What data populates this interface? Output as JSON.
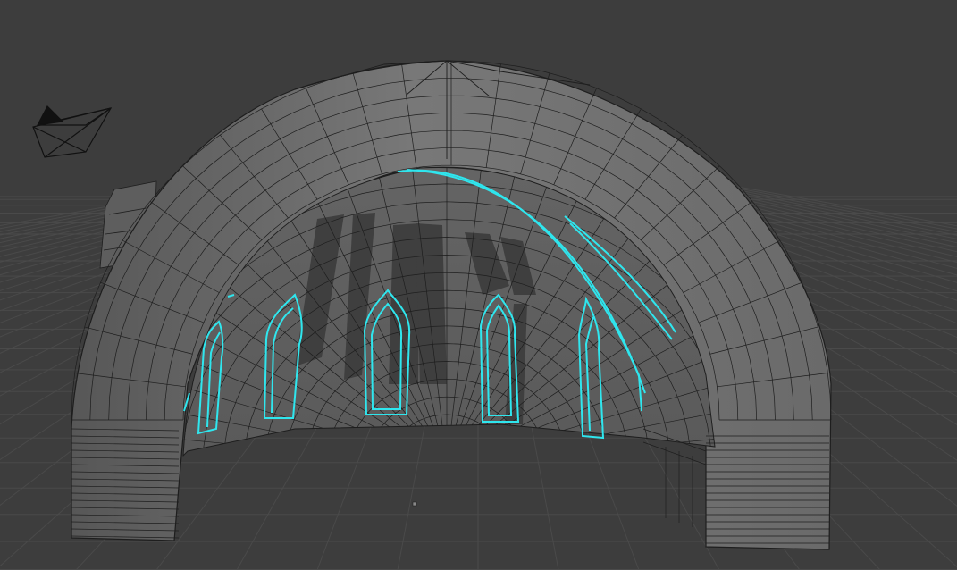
{
  "viewport": {
    "background_color": "#3d3d3d",
    "grid_color": "#4a4a4a",
    "mesh_fill_color": "#6b6b6b",
    "mesh_wire_color": "#1e1e1e",
    "selection_color": "#2fe6ee"
  },
  "scene_objects": [
    {
      "name": "camera",
      "icon": "camera-icon"
    },
    {
      "name": "dome-arch-mesh",
      "icon": "mesh-icon"
    },
    {
      "name": "origin-point",
      "icon": "origin-dot-icon"
    }
  ]
}
